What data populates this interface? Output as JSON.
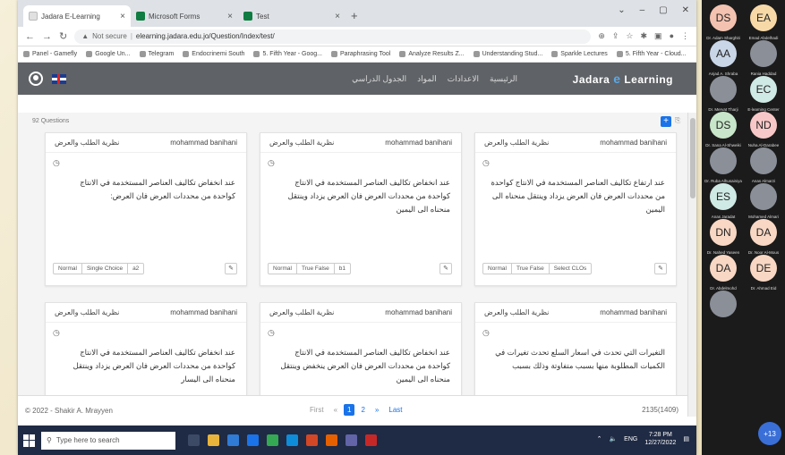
{
  "browser": {
    "tabs": [
      {
        "title": "Jadara E-Learning",
        "active": true
      },
      {
        "title": "Microsoft Forms",
        "active": false
      },
      {
        "title": "Test",
        "active": false
      }
    ],
    "url_warning": "Not secure",
    "url": "elearning.jadara.edu.jo/Question/Index/test/",
    "bookmarks": [
      "Panel - Gamefly",
      "Google Un...",
      "Telegram",
      "Endocrinemi South",
      "5. Fifth Year - Goog...",
      "Paraphrasing Tool",
      "Analyze Results Z...",
      "Understanding Stud...",
      "Sparkle Lectures",
      "5. Fifth Year - Cloud..."
    ]
  },
  "app": {
    "brand_pre": "Jadara ",
    "brand_e": "e",
    "brand_post": " Learning",
    "nav": [
      "الرئيسية",
      "الاعدادات",
      "المواد",
      "الجدول الدراسي"
    ],
    "questions_count": "92 Questions",
    "cards": [
      {
        "author": "mohammad banihani",
        "category": "نظرية الطلب والعرض",
        "text": "عند انخفاض تكاليف العناصر المستخدمة في الانتاج كواحدة من محددات العرض فان العرض:",
        "tags": [
          "Normal",
          "Single Choice",
          "a2"
        ]
      },
      {
        "author": "mohammad banihani",
        "category": "نظرية الطلب والعرض",
        "text": "عند انخفاض تكاليف العناصر المستخدمة في الانتاج كواحدة من محددات العرض فان العرض يزداد وينتقل منحناه الى اليمين",
        "tags": [
          "Normal",
          "True False",
          "b1"
        ]
      },
      {
        "author": "mohammad banihani",
        "category": "نظرية الطلب والعرض",
        "text": "عند ارتفاع تكاليف العناصر المستخدمة في الانتاج كواحدة من محددات العرض فان العرض يزداد وينتقل منحناه الى اليمين",
        "tags": [
          "Normal",
          "True False",
          "Select CLOs"
        ]
      },
      {
        "author": "mohammad banihani",
        "category": "نظرية الطلب والعرض",
        "text": "عند انخفاض تكاليف العناصر المستخدمة في الانتاج كواحدة من محددات العرض فان العرض يزداد وينتقل منحناه الى اليسار"
      },
      {
        "author": "mohammad banihani",
        "category": "نظرية الطلب والعرض",
        "text": "عند انخفاض تكاليف العناصر المستخدمة في الانتاج كواحدة من محددات العرض فان العرض ينخفض وينتقل منحناه الى اليمين"
      },
      {
        "author": "mohammad banihani",
        "category": "نظرية الطلب والعرض",
        "text": "التغيرات التي تحدث في اسعار السلع تحدث تغيرات في الكميات المطلوبة منها بسبب متفاوتة وذلك بسبب"
      }
    ],
    "footer": {
      "copyright": "© 2022 - Shakir A. Mrayyen",
      "pager": {
        "first": "First",
        "prev": "«",
        "pages": [
          "1",
          "2"
        ],
        "next": "»",
        "last": "Last"
      },
      "total": "2135(1409)"
    }
  },
  "taskbar": {
    "search_placeholder": "Type here to search",
    "time": "7:28 PM",
    "date": "12/27/2022",
    "lang": "ENG"
  },
  "participants": [
    {
      "initials": "DS",
      "name": "Dr. Adam Sharghiti",
      "color": "#f4c2b0"
    },
    {
      "initials": "EA",
      "name": "Emad Abdelhadi",
      "color": "#f7d9a8"
    },
    {
      "initials": "AA",
      "name": "Anjad A. Shraba",
      "color": "#c9d6e8"
    },
    {
      "initials": "",
      "name": "Rania Haddad",
      "color": "#8a8f98"
    },
    {
      "initials": "",
      "name": "Dr. Mervat Tharji",
      "color": "#8a8f98"
    },
    {
      "initials": "EC",
      "name": "E-learning Center",
      "color": "#cfe9e4"
    },
    {
      "initials": "DS",
      "name": "Dr. Sana Al-Shweiki",
      "color": "#c8e6c9"
    },
    {
      "initials": "ND",
      "name": "Nuha Al-Darabee",
      "color": "#f8c8c8"
    },
    {
      "initials": "",
      "name": "Dr. Ruba Alhusainiya",
      "color": "#8a8f98"
    },
    {
      "initials": "",
      "name": "Anas Almarzi",
      "color": "#8a8f98"
    },
    {
      "initials": "ES",
      "name": "Anas Jaradat",
      "color": "#cfe9e4"
    },
    {
      "initials": "",
      "name": "Mohamed Almari",
      "color": "#8a8f98"
    },
    {
      "initials": "DN",
      "name": "Dr. Nahed Yaseen",
      "color": "#f8d7c4"
    },
    {
      "initials": "DA",
      "name": "Dr. Noor Al-Mous",
      "color": "#f8d7c4"
    },
    {
      "initials": "DA",
      "name": "Dr. Abdelmohd",
      "color": "#f8d7c4"
    },
    {
      "initials": "DE",
      "name": "Dr. Ahmad Eid",
      "color": "#f8d7c4"
    },
    {
      "initials": "",
      "name": "",
      "color": "#8a8f98"
    }
  ],
  "more_participants": "+13"
}
